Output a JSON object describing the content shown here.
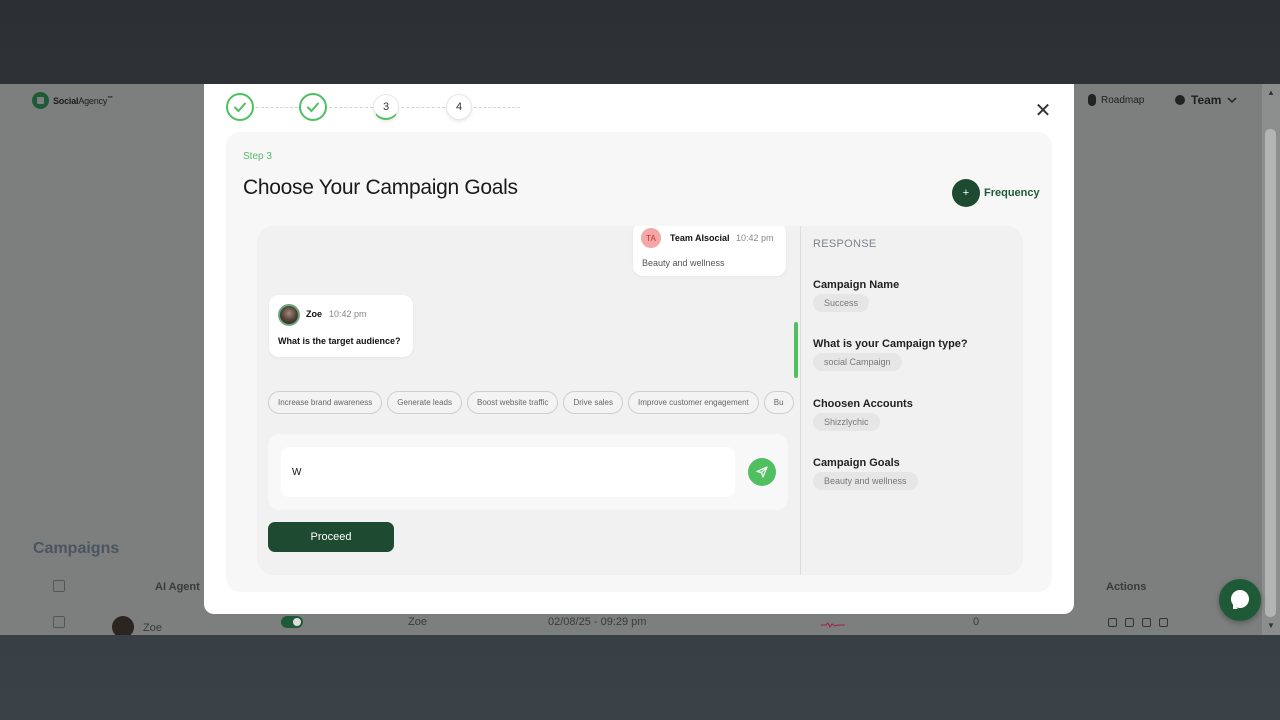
{
  "app": {
    "brand_name_bold": "Social",
    "brand_name_rest": "Agency",
    "brand_tm": "™",
    "roadmap_label": "Roadmap",
    "team_label": "Team",
    "campaigns_title": "Campaigns",
    "table": {
      "col_agent": "AI Agent",
      "col_actions": "Actions",
      "row": {
        "name": "Zoe",
        "agent": "Zoe",
        "date": "02/08/25 - 09:29 pm",
        "count": "0"
      }
    }
  },
  "modal": {
    "steps": [
      {
        "state": "done"
      },
      {
        "state": "done"
      },
      {
        "label": "3",
        "state": "active"
      },
      {
        "label": "4",
        "state": "pending"
      }
    ],
    "step_label": "Step 3",
    "title": "Choose Your Campaign Goals",
    "frequency_label": "Frequency",
    "frequency_icon": "+",
    "messages": {
      "team": {
        "avatar": "TA",
        "author": "Team AIsocial",
        "time": "10:42 pm",
        "text": "Beauty and wellness"
      },
      "zoe": {
        "author": "Zoe",
        "time": "10:42 pm",
        "text": "What is the target audience?"
      }
    },
    "chips": [
      "Increase brand awareness",
      "Generate leads",
      "Boost website traffic",
      "Drive sales",
      "Improve customer engagement",
      "Bu"
    ],
    "input_value": "W",
    "proceed_label": "Proceed",
    "response": {
      "title": "RESPONSE",
      "items": [
        {
          "label": "Campaign Name",
          "value": "Success"
        },
        {
          "label": "What is your Campaign type?",
          "value": "social Campaign"
        },
        {
          "label": "Choosen Accounts",
          "value": "Shizzlychic"
        },
        {
          "label": "Campaign Goals",
          "value": "Beauty and wellness"
        }
      ]
    }
  },
  "colors": {
    "accent_green": "#4fbf5f",
    "dark_green": "#1d4a30",
    "overlay": "#7d7f7f"
  },
  "icons": [
    "check-icon",
    "close-icon",
    "plus-icon",
    "send-icon",
    "mic-icon",
    "user-icon",
    "chevron-down-icon",
    "chat-bubble-icon"
  ]
}
